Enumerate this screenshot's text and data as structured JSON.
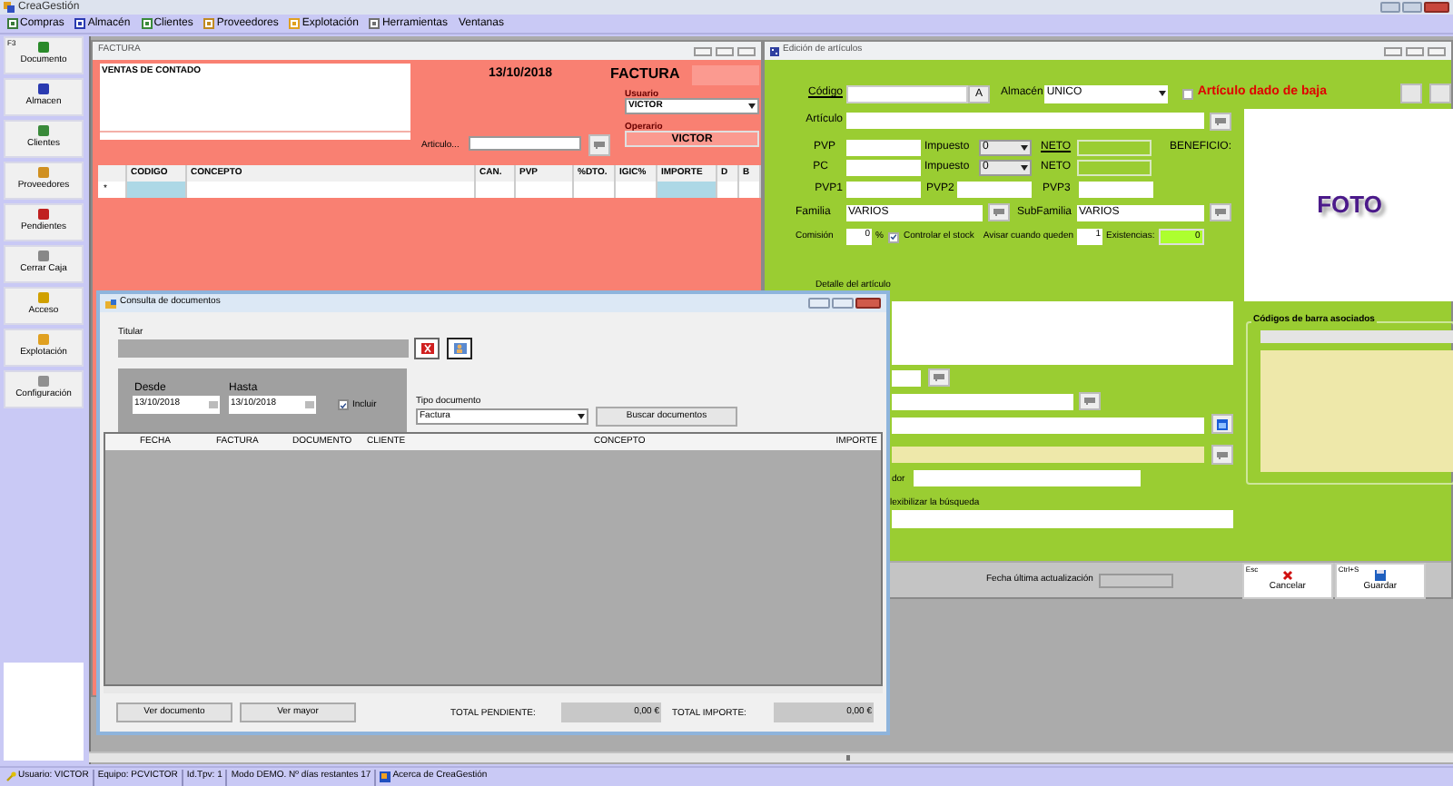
{
  "app": {
    "title": "CreaGestión"
  },
  "menu": [
    {
      "label": "Compras"
    },
    {
      "label": "Almacén"
    },
    {
      "label": "Clientes"
    },
    {
      "label": "Proveedores"
    },
    {
      "label": "Explotación"
    },
    {
      "label": "Herramientas"
    },
    {
      "label": "Ventanas"
    }
  ],
  "sidebar": [
    {
      "label": "Documento",
      "shortcut": "F3"
    },
    {
      "label": "Almacen"
    },
    {
      "label": "Clientes"
    },
    {
      "label": "Proveedores"
    },
    {
      "label": "Pendientes"
    },
    {
      "label": "Cerrar Caja"
    },
    {
      "label": "Acceso"
    },
    {
      "label": "Explotación"
    },
    {
      "label": "Configuración"
    }
  ],
  "factura": {
    "title": "FACTURA",
    "client": "VENTAS DE CONTADO",
    "date": "13/10/2018",
    "doc_type": "FACTURA",
    "usuario_label": "Usuario",
    "usuario": "VICTOR",
    "operario_label": "Operario",
    "operario": "VICTOR",
    "articulo_label": "Articulo...",
    "columns": [
      "CODIGO",
      "CONCEPTO",
      "CAN.",
      "PVP",
      "%DTO.",
      "IGIC%",
      "IMPORTE",
      "D",
      "B"
    ],
    "new_row_marker": "*"
  },
  "articulos": {
    "title": "Edición de artículos",
    "codigo_label": "Código",
    "code_button": "A",
    "almacen_label": "Almacén",
    "almacen": "UNICO",
    "baja": {
      "label": "Artículo dado de baja",
      "checked": false
    },
    "articulo_label": "Artículo",
    "pvp_label": "PVP",
    "impuesto_label": "Impuesto",
    "impuesto_pvp": "0",
    "neto_label": "NETO",
    "beneficio_label": "BENEFICIO:",
    "pc_label": "PC",
    "impuesto_pc_label": "Impuesto",
    "impuesto_pc": "0",
    "neto_pc_label": "NETO",
    "pvp1_label": "PVP1",
    "pvp2_label": "PVP2",
    "pvp3_label": "PVP3",
    "familia_label": "Familia",
    "familia": "VARIOS",
    "subfamilia_label": "SubFamilia",
    "subfamilia": "VARIOS",
    "comision_label": "Comisión",
    "comision": "0",
    "percent": "%",
    "stock": {
      "label": "Controlar el stock",
      "checked": true
    },
    "avisar_label": "Avisar cuando queden",
    "avisar": "1",
    "existencias_label": "Existencias:",
    "existencias": "0",
    "foto": "FOTO",
    "detalle_label": "Detalle del artículo",
    "proveedor_label_fragment": "dor",
    "flexibilizar_label_fragment": "lexibilizar la búsqueda",
    "barcodes_title": "Códigos de barra asociados",
    "fecha_label": "Fecha última actualización",
    "cancel": {
      "shortcut": "Esc",
      "label": "Cancelar"
    },
    "save": {
      "shortcut": "Ctrl+S",
      "label": "Guardar"
    }
  },
  "consulta": {
    "title": "Consulta de documentos",
    "titular_label": "Titular",
    "desde_label": "Desde",
    "desde": "13/10/2018",
    "hasta_label": "Hasta",
    "hasta": "13/10/2018",
    "incluir": {
      "label": "Incluir",
      "checked": true
    },
    "tipo_label": "Tipo documento",
    "tipo": "Factura",
    "search_button": "Buscar documentos",
    "columns": [
      "FECHA",
      "FACTURA",
      "DOCUMENTO",
      "CLIENTE",
      "CONCEPTO",
      "IMPORTE"
    ],
    "buttons": [
      "Ver documento",
      "Ver mayor"
    ],
    "total_pendiente_label": "TOTAL PENDIENTE:",
    "total_pendiente": "0,00 €",
    "total_importe_label": "TOTAL IMPORTE:",
    "total_importe": "0,00 €"
  },
  "status_bar": [
    {
      "text": "Usuario: VICTOR",
      "kind": "key"
    },
    {
      "text": "Equipo: PCVICTOR",
      "kind": "plain"
    },
    {
      "text": "Id.Tpv: 1",
      "kind": "plain"
    },
    {
      "text": "Modo DEMO. Nº días restantes 17",
      "kind": "plain"
    },
    {
      "text": "Acerca de CreaGestión",
      "kind": "link"
    }
  ]
}
